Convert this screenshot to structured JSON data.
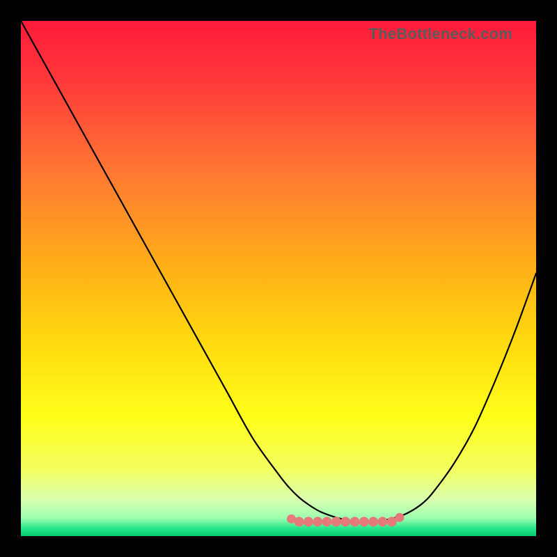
{
  "watermark": "TheBottleneck.com",
  "colors": {
    "black": "#000000",
    "curve_stroke": "#000000",
    "marker_fill": "#e67a7a",
    "marker_stroke": "#d96a6a",
    "gradient_stops": [
      {
        "offset": 0.0,
        "color": "#ff1a3a"
      },
      {
        "offset": 0.12,
        "color": "#ff3a3a"
      },
      {
        "offset": 0.3,
        "color": "#ff7a32"
      },
      {
        "offset": 0.48,
        "color": "#ffb017"
      },
      {
        "offset": 0.62,
        "color": "#ffd90f"
      },
      {
        "offset": 0.77,
        "color": "#ffff1a"
      },
      {
        "offset": 0.87,
        "color": "#f4ff60"
      },
      {
        "offset": 0.93,
        "color": "#d9ffb0"
      },
      {
        "offset": 0.965,
        "color": "#9dffb0"
      },
      {
        "offset": 0.985,
        "color": "#26e68a"
      },
      {
        "offset": 1.0,
        "color": "#07c96e"
      }
    ]
  },
  "chart_data": {
    "type": "line",
    "title": "",
    "xlabel": "",
    "ylabel": "",
    "xlim": [
      0,
      100
    ],
    "ylim": [
      0,
      100
    ],
    "x": [
      0,
      5,
      10,
      15,
      20,
      25,
      30,
      35,
      40,
      45,
      50,
      52,
      54,
      56,
      58,
      60,
      62,
      64,
      66,
      68,
      70,
      72,
      74,
      76,
      78,
      80,
      84,
      88,
      92,
      96,
      100
    ],
    "values": [
      100,
      91,
      82,
      73,
      64,
      55,
      46,
      37,
      28,
      19,
      12,
      9.5,
      7.5,
      6.0,
      4.8,
      4.0,
      3.4,
      3.0,
      2.8,
      2.8,
      3.0,
      3.4,
      4.0,
      5.0,
      6.4,
      8.5,
      14,
      21,
      30,
      40,
      51
    ],
    "flat_region_x": [
      54,
      72
    ],
    "notes": "Asymmetric V-shaped curve. Left arm descends roughly linearly from top-left; right arm rises more steeply over a shorter horizontal span. Bottom of the valley is flattened between roughly x=54 and x=72 and is overlaid with a salmon/pink rounded marker band at the minimum (y≈3). Background is a smooth vertical gradient from red at top through orange and yellow to a thin green strip at the very bottom. No axis ticks, labels, gridlines, or legend are visible. A grey watermark 'TheBottleneck.com' sits at the top-right of the plot area."
  }
}
